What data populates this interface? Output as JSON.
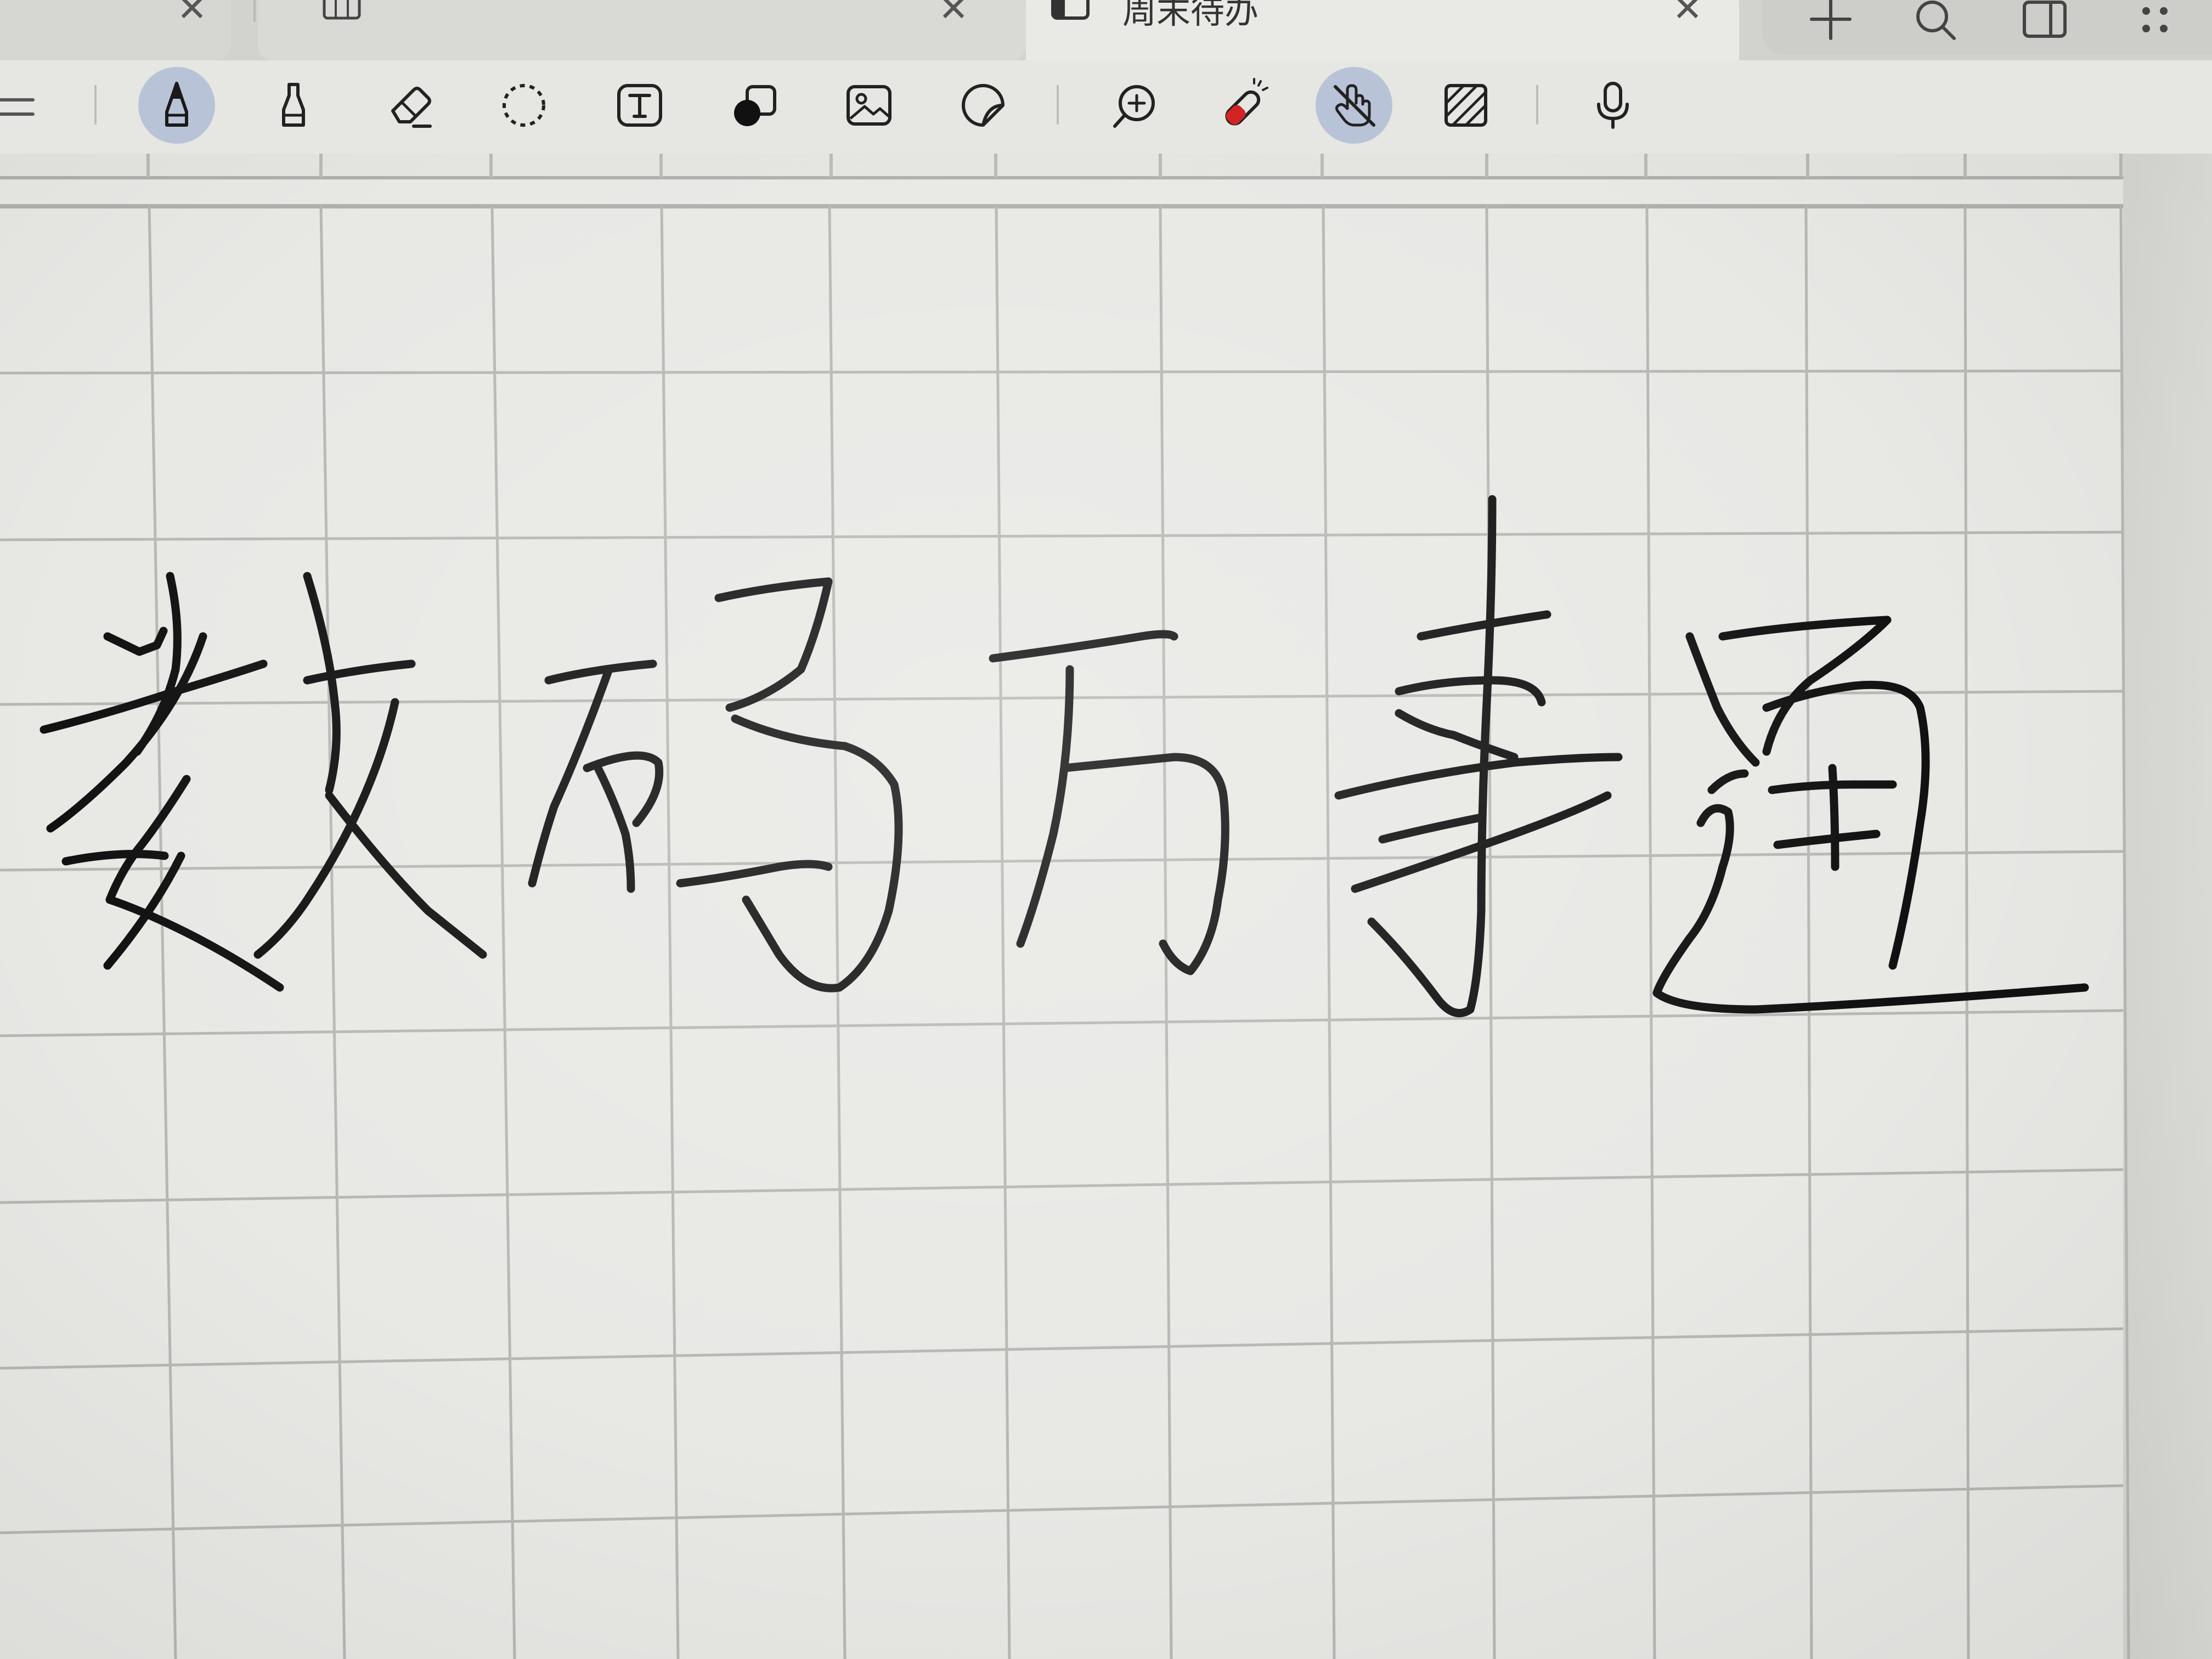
{
  "tabs": [
    {
      "label": "",
      "icon": "grid-notebook-icon",
      "closable": true
    },
    {
      "label": "",
      "icon": "grid-notebook-icon",
      "closable": true
    },
    {
      "label": "周末待办",
      "icon": "notebook-icon",
      "closable": true,
      "active": true
    }
  ],
  "top_actions": [
    "add-icon",
    "search-icon",
    "sidebar-toggle-icon",
    "more-icon"
  ],
  "toolbar": {
    "tools": [
      {
        "name": "pen-tool",
        "icon": "pen-icon",
        "active": true
      },
      {
        "name": "highlighter-tool",
        "icon": "highlighter-icon",
        "active": false
      },
      {
        "name": "eraser-tool",
        "icon": "eraser-icon",
        "active": false
      },
      {
        "name": "lasso-tool",
        "icon": "lasso-icon",
        "active": false
      },
      {
        "name": "text-tool",
        "icon": "text-box-icon",
        "active": false
      },
      {
        "name": "shape-tool",
        "icon": "shapes-icon",
        "active": false
      },
      {
        "name": "image-tool",
        "icon": "image-icon",
        "active": false
      },
      {
        "name": "sticker-tool",
        "icon": "sticker-icon",
        "active": false
      },
      {
        "name": "zoom-window-tool",
        "icon": "zoom-window-icon",
        "active": false
      },
      {
        "name": "laser-pointer-tool",
        "icon": "laser-pointer-icon",
        "active": false
      },
      {
        "name": "touch-draw-toggle",
        "icon": "hand-touch-icon",
        "active": true
      },
      {
        "name": "page-template-tool",
        "icon": "pattern-icon",
        "active": false
      },
      {
        "name": "voice-record-tool",
        "icon": "microphone-icon",
        "active": false
      }
    ]
  },
  "page": {
    "handwritten_text": "数码万事通",
    "paper": "grid"
  },
  "colors": {
    "paper": "#e8e8e5",
    "grid_line": "#b7b7b3",
    "ink": "#111111",
    "active_tool_bg": "#b9c3d8",
    "laser_red": "#d32424"
  }
}
